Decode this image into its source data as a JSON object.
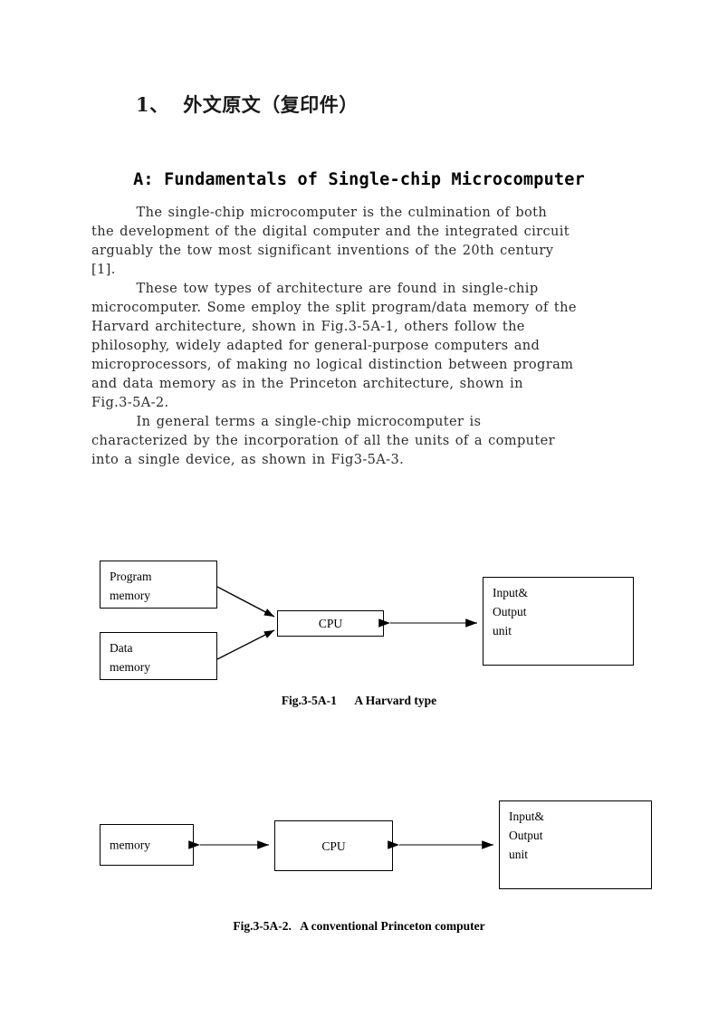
{
  "document": {
    "section_heading": "1、  外文原文（复印件）",
    "article_title": "A: Fundamentals of Single-chip Microcomputer"
  },
  "paragraphs": [
    {
      "id": "p1",
      "lines": [
        "        The single-chip microcomputer is the culmination of both",
        "the development of the digital computer and the integrated circuit",
        "arguably the tow most significant inventions of the 20th century",
        "[1]."
      ]
    },
    {
      "id": "p2",
      "lines": [
        "        These tow types of architecture are found in single-chip",
        "microcomputer. Some employ the split program/data memory of the",
        "Harvard architecture, shown in Fig.3-5A-1, others follow the",
        "philosophy, widely adapted for general-purpose computers and",
        "microprocessors, of making no logical distinction between program",
        "and data memory as in the Princeton architecture, shown in",
        "Fig.3-5A-2."
      ]
    },
    {
      "id": "p3",
      "lines": [
        "        In general terms a single-chip microcomputer is",
        "characterized by the incorporation of all the units of a computer",
        "into a single device, as shown in Fig3-5A-3."
      ]
    }
  ],
  "figures": [
    {
      "id": "fig-harvard",
      "caption": "Fig.3-5A-1      A Harvard type",
      "nodes": {
        "program_memory": "Program\nmemory",
        "data_memory": "Data\nmemory",
        "cpu": "CPU",
        "io_unit": "Input&\nOutput\nunit"
      }
    },
    {
      "id": "fig-princeton",
      "caption": "Fig.3-5A-2.   A conventional Princeton computer",
      "nodes": {
        "memory": "memory",
        "cpu": "CPU",
        "io_unit": "Input&\nOutput\nunit"
      }
    }
  ],
  "colors": {
    "text": "#2b2b2b",
    "heading": "#1a1a1a",
    "line": "#000000",
    "background": "#ffffff"
  }
}
